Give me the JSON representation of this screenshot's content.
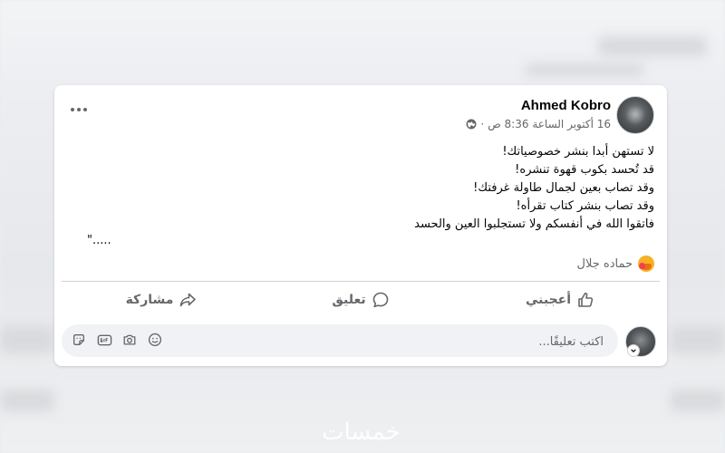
{
  "post": {
    "author": "Ahmed Kobro",
    "timestamp": "16 أكتوبر الساعة 8:36 ص",
    "separator": "·",
    "privacy_icon": "globe-icon",
    "more_icon": "more-horizontal-icon",
    "lines": [
      "لا تستهن أبدا بنشر خصوصياتك!",
      "قد تُحسد بكوب قهوة تنشره!",
      "وقد تصاب بعين لجمال طاولة غرفتك!",
      "وقد تصاب بنشر كتاب تقرأه!",
      "فاتقوا الله في أنفسكم ولا تستجلبوا العين والحسد"
    ],
    "ellipsis": "\".....",
    "reactions": {
      "icon": "care-emoji-icon",
      "names": "حماده جلال"
    }
  },
  "actions": {
    "like": "أعجبني",
    "comment": "تعليق",
    "share": "مشاركة"
  },
  "comment_box": {
    "placeholder": "اكتب تعليقًا...",
    "icons": [
      "emoji-icon",
      "camera-icon",
      "gif-icon",
      "sticker-icon"
    ]
  },
  "watermark": "خمسات",
  "colors": {
    "text_primary": "#050505",
    "text_secondary": "#65676b",
    "input_bg": "#f0f2f5",
    "divider": "#ced0d4"
  }
}
